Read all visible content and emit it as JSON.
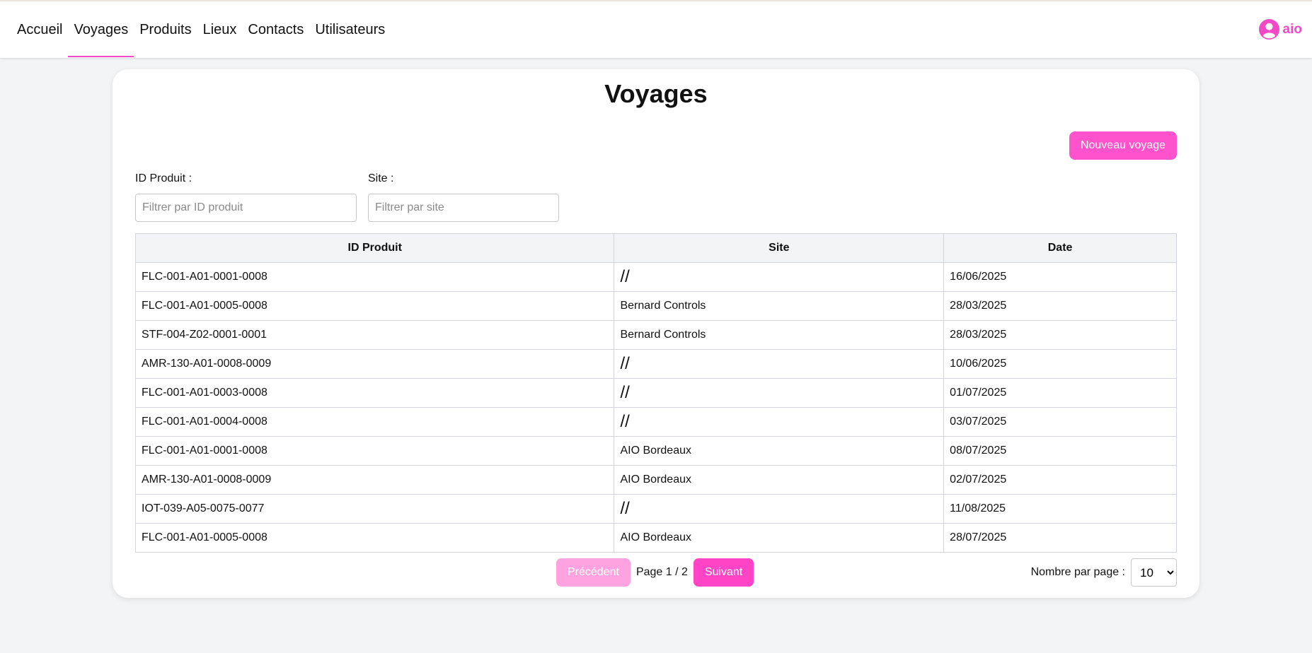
{
  "nav": {
    "items": [
      {
        "label": "Accueil",
        "name": "nav-accueil",
        "active": false
      },
      {
        "label": "Voyages",
        "name": "nav-voyages",
        "active": true
      },
      {
        "label": "Produits",
        "name": "nav-produits",
        "active": false
      },
      {
        "label": "Lieux",
        "name": "nav-lieux",
        "active": false
      },
      {
        "label": "Contacts",
        "name": "nav-contacts",
        "active": false
      },
      {
        "label": "Utilisateurs",
        "name": "nav-utilisateurs",
        "active": false
      }
    ],
    "user": {
      "name": "aio",
      "icon": "user-circle-icon"
    }
  },
  "page": {
    "title": "Voyages",
    "new_button": "Nouveau voyage"
  },
  "filters": {
    "product_label": "ID Produit :",
    "product_placeholder": "Filtrer par ID produit",
    "product_value": "",
    "site_label": "Site :",
    "site_placeholder": "Filtrer par site",
    "site_value": ""
  },
  "table": {
    "headers": [
      "ID Produit",
      "Site",
      "Date"
    ],
    "rows": [
      [
        "FLC-001-A01-0001-0008",
        "//",
        "16/06/2025"
      ],
      [
        "FLC-001-A01-0005-0008",
        "Bernard Controls",
        "28/03/2025"
      ],
      [
        "STF-004-Z02-0001-0001",
        "Bernard Controls",
        "28/03/2025"
      ],
      [
        "AMR-130-A01-0008-0009",
        "//",
        "10/06/2025"
      ],
      [
        "FLC-001-A01-0003-0008",
        "//",
        "01/07/2025"
      ],
      [
        "FLC-001-A01-0004-0008",
        "//",
        "03/07/2025"
      ],
      [
        "FLC-001-A01-0001-0008",
        "AIO Bordeaux",
        "08/07/2025"
      ],
      [
        "AMR-130-A01-0008-0009",
        "AIO Bordeaux",
        "02/07/2025"
      ],
      [
        "IOT-039-A05-0075-0077",
        "//",
        "11/08/2025"
      ],
      [
        "FLC-001-A01-0005-0008",
        "AIO Bordeaux",
        "28/07/2025"
      ]
    ]
  },
  "pagination": {
    "prev_label": "Précédent",
    "next_label": "Suivant",
    "page_info": "Page 1 / 2",
    "per_page_label": "Nombre par page :",
    "per_page_value": "10",
    "per_page_options": [
      "10"
    ]
  },
  "colors": {
    "accent": "#ff52cc",
    "accent_disabled": "#ffa3e0",
    "background": "#f3f4f6"
  }
}
